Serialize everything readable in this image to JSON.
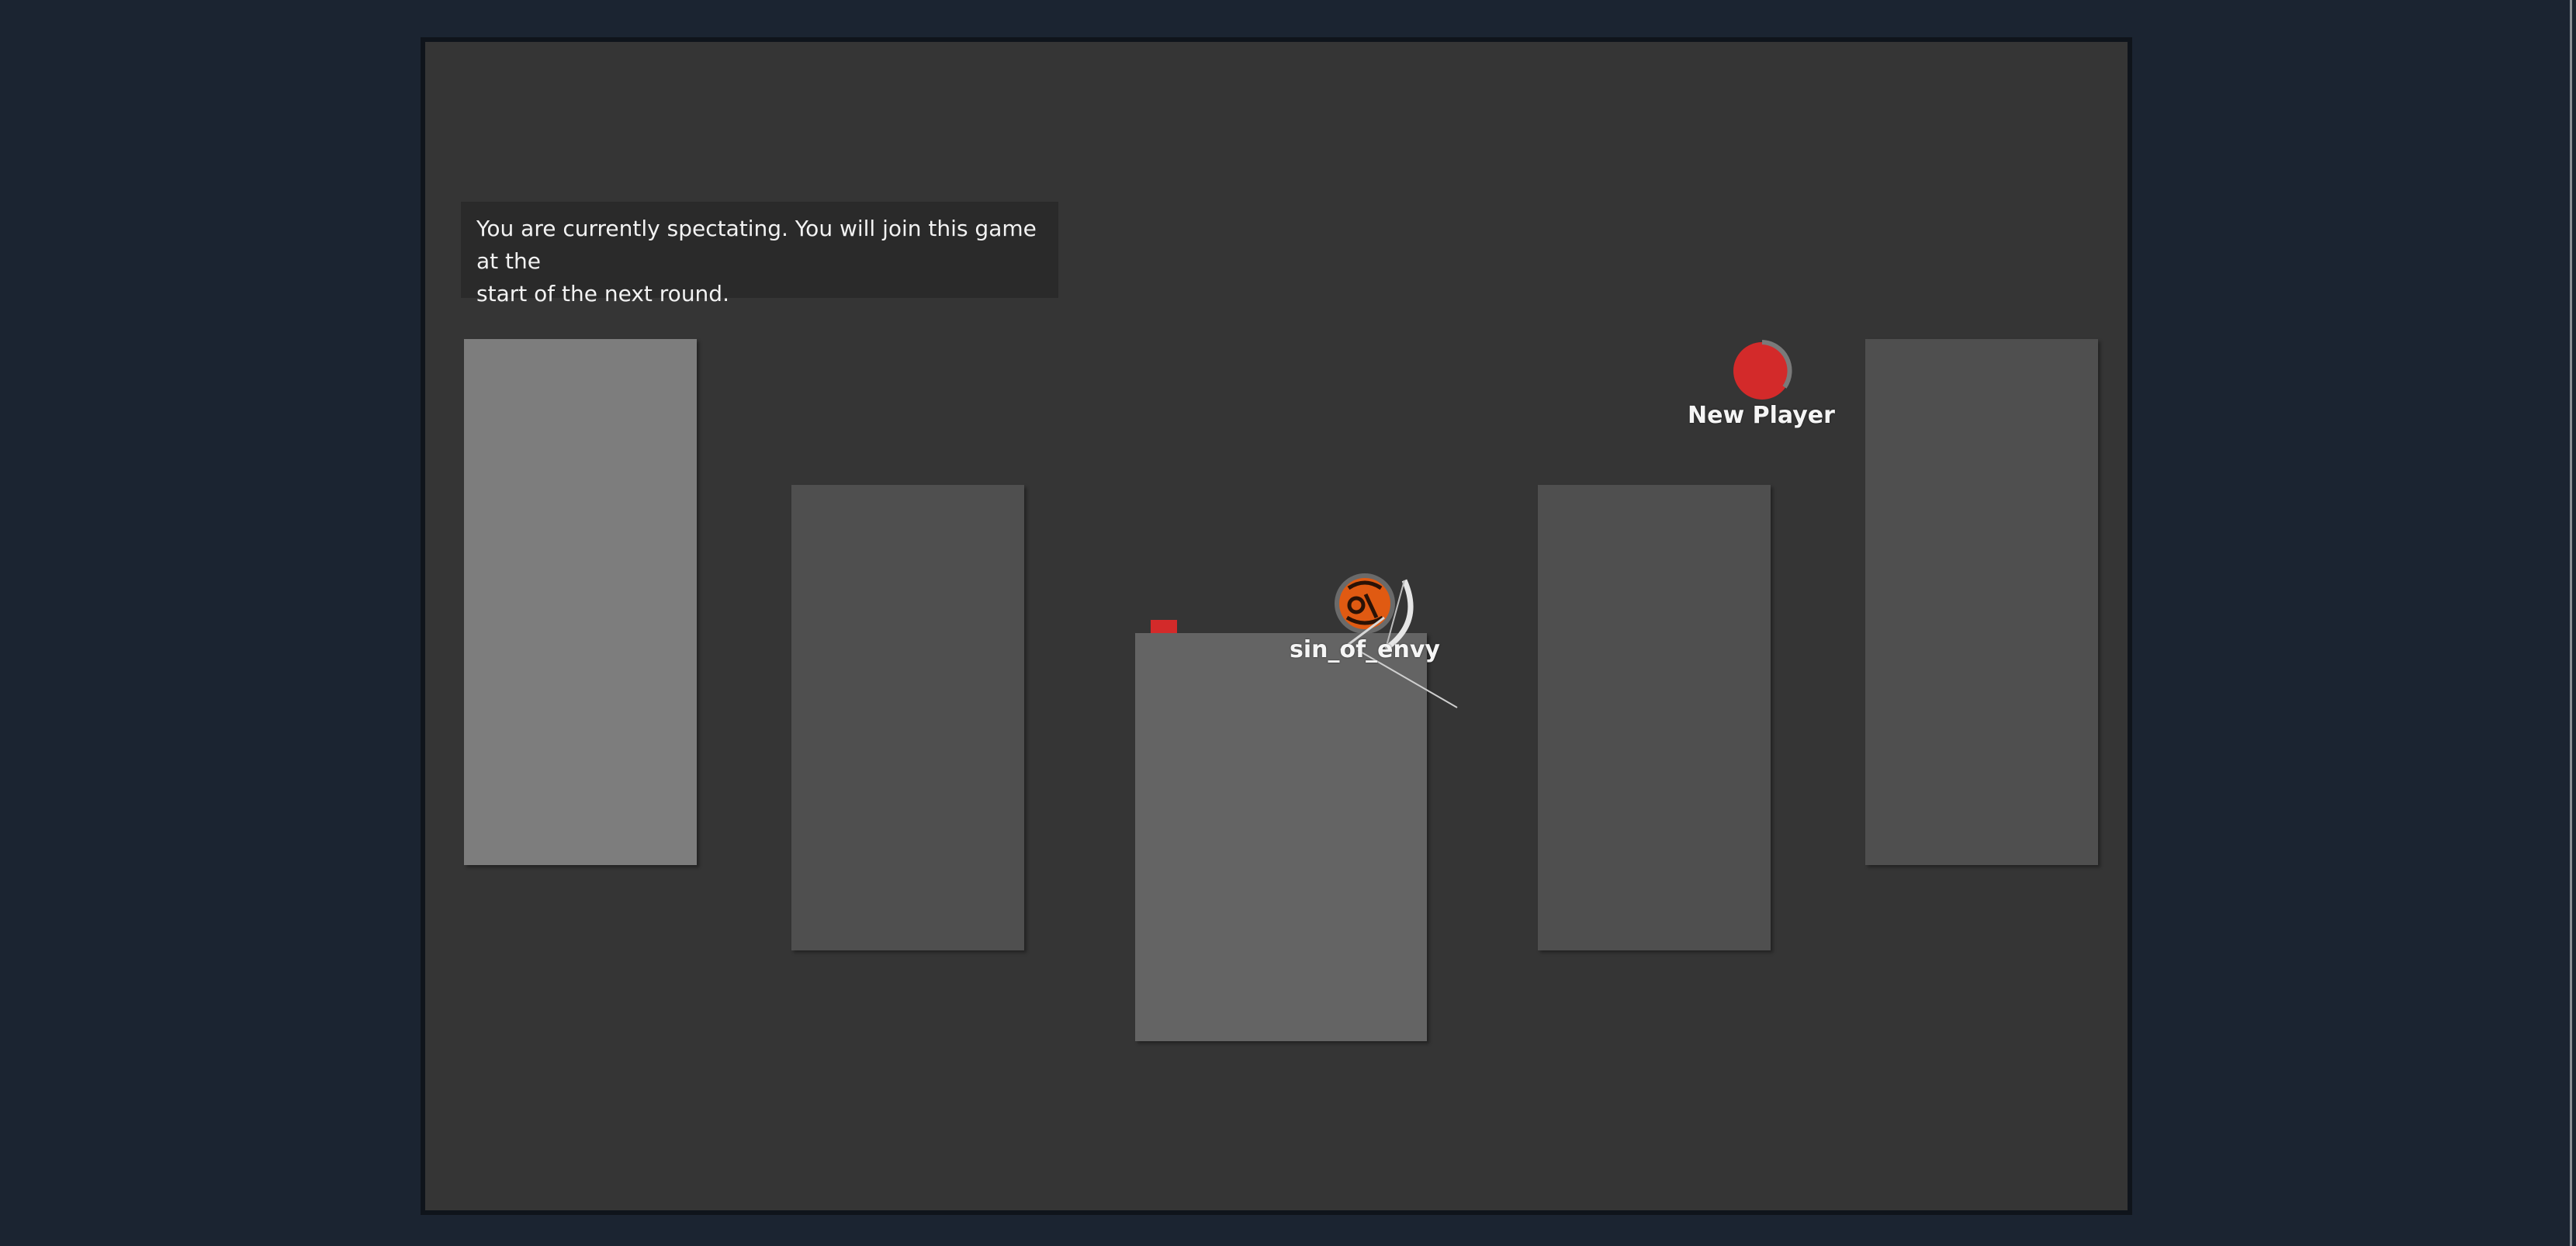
{
  "banner": {
    "line1": "You are currently spectating. You will join this game at the",
    "line2": "start of the next round."
  },
  "players": [
    {
      "name": "sin_of_envy",
      "color": "#e05a12"
    },
    {
      "name": "New Player",
      "color": "#d32a2a"
    }
  ],
  "colors": {
    "page_background": "#1b2431",
    "arena_background": "#353535",
    "platform_light": "#7d7d7d",
    "platform_mid": "#646464",
    "platform_dark": "#4f4f4f",
    "pickup": "#d32a2a"
  },
  "icons": [
    "bow-icon",
    "player-emblem-icon"
  ]
}
